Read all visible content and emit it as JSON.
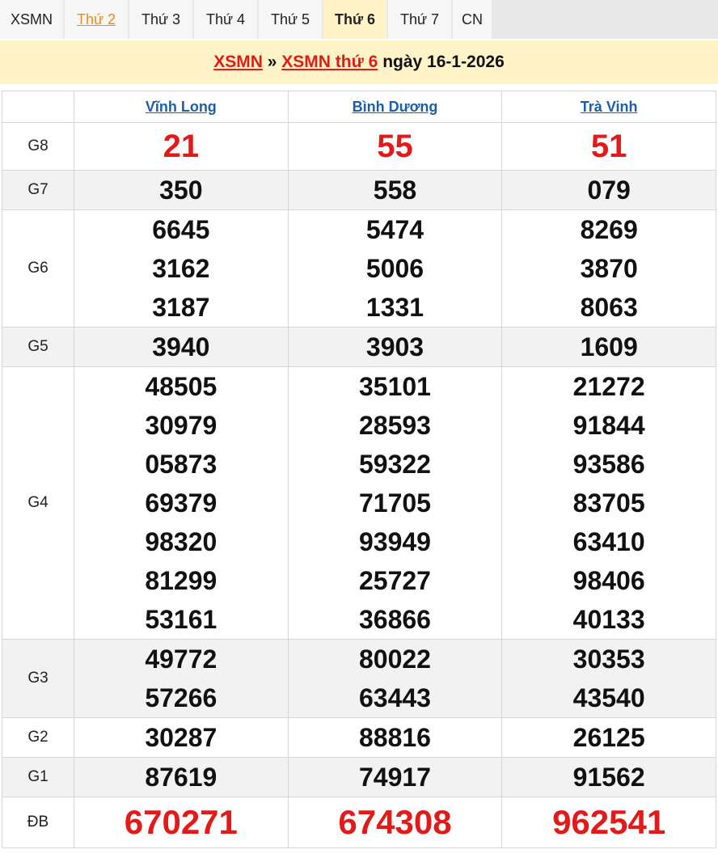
{
  "tabs": [
    "XSMN",
    "Thứ 2",
    "Thứ 3",
    "Thứ 4",
    "Thứ 5",
    "Thứ 6",
    "Thứ 7",
    "CN"
  ],
  "title": {
    "link1": "XSMN",
    "sep": "»",
    "link2": "XSMN thứ 6",
    "rest": "ngày 16-1-2026"
  },
  "provinces": [
    "Vĩnh Long",
    "Bình Dương",
    "Trà Vinh"
  ],
  "prizes": {
    "g8": {
      "label": "G8",
      "values": [
        [
          "21"
        ],
        [
          "55"
        ],
        [
          "51"
        ]
      ]
    },
    "g7": {
      "label": "G7",
      "values": [
        [
          "350"
        ],
        [
          "558"
        ],
        [
          "079"
        ]
      ]
    },
    "g6": {
      "label": "G6",
      "values": [
        [
          "6645",
          "3162",
          "3187"
        ],
        [
          "5474",
          "5006",
          "1331"
        ],
        [
          "8269",
          "3870",
          "8063"
        ]
      ]
    },
    "g5": {
      "label": "G5",
      "values": [
        [
          "3940"
        ],
        [
          "3903"
        ],
        [
          "1609"
        ]
      ]
    },
    "g4": {
      "label": "G4",
      "values": [
        [
          "48505",
          "30979",
          "05873",
          "69379",
          "98320",
          "81299",
          "53161"
        ],
        [
          "35101",
          "28593",
          "59322",
          "71705",
          "93949",
          "25727",
          "36866"
        ],
        [
          "21272",
          "91844",
          "93586",
          "83705",
          "63410",
          "98406",
          "40133"
        ]
      ]
    },
    "g3": {
      "label": "G3",
      "values": [
        [
          "49772",
          "57266"
        ],
        [
          "80022",
          "63443"
        ],
        [
          "30353",
          "43540"
        ]
      ]
    },
    "g2": {
      "label": "G2",
      "values": [
        [
          "30287"
        ],
        [
          "88816"
        ],
        [
          "26125"
        ]
      ]
    },
    "g1": {
      "label": "G1",
      "values": [
        [
          "87619"
        ],
        [
          "74917"
        ],
        [
          "91562"
        ]
      ]
    },
    "db": {
      "label": "ĐB",
      "values": [
        [
          "670271"
        ],
        [
          "674308"
        ],
        [
          "962541"
        ]
      ]
    }
  }
}
